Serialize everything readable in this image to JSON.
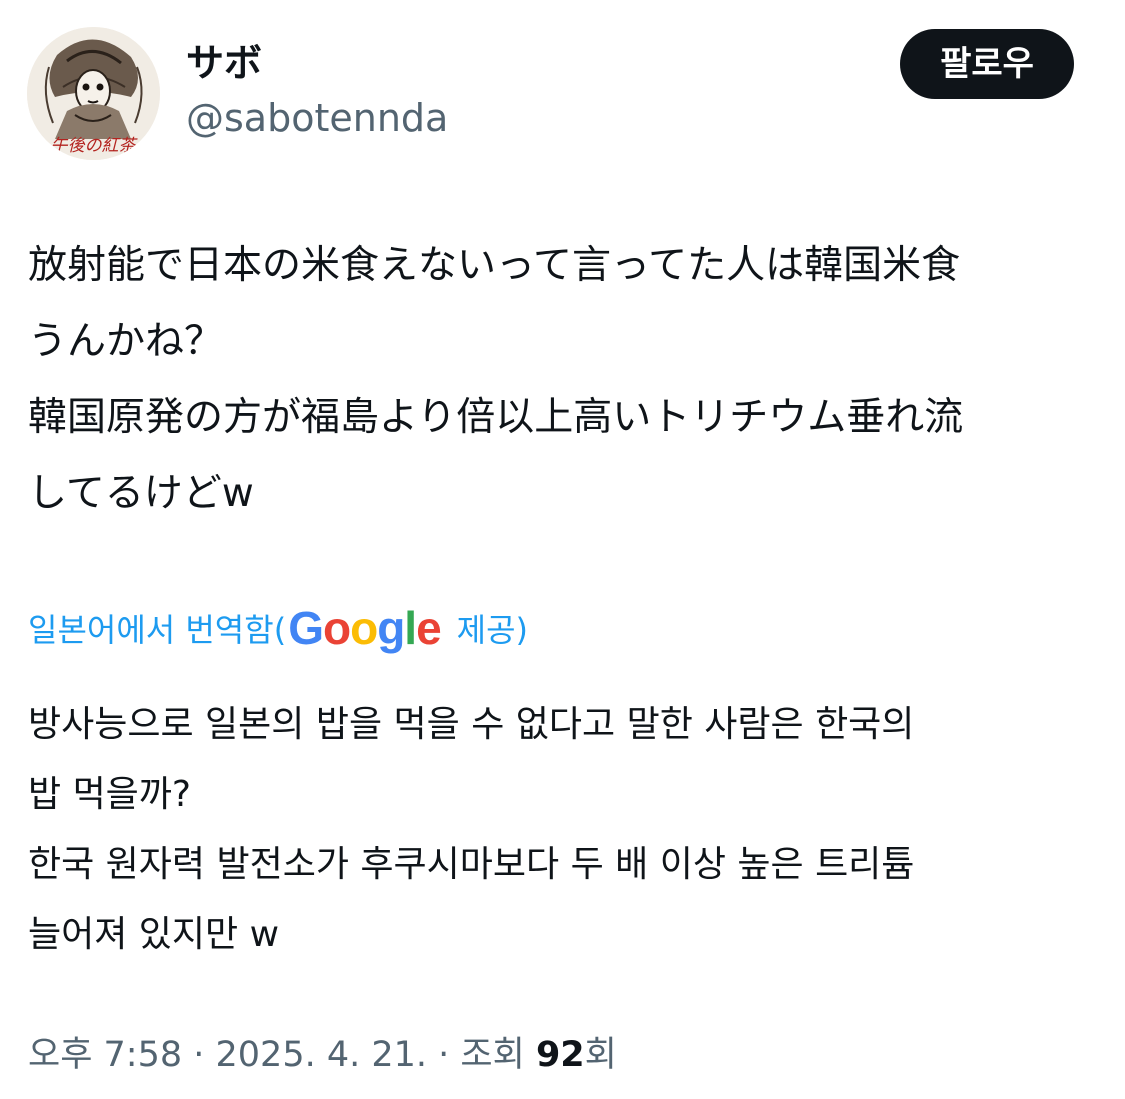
{
  "user": {
    "display_name": "サボ",
    "handle": "@sabotennda",
    "avatar_icon": "avatar-image",
    "avatar_text": "午後の紅茶"
  },
  "follow_button": {
    "label": "팔로우"
  },
  "tweet": {
    "original_lines": [
      "放射能で日本の米食えないって言ってた人は韓国米食",
      "うんかね？",
      "韓国原発の方が福島より倍以上高いトリチウム垂れ流",
      "してるけどw"
    ],
    "translation_prefix": "일본어에서 번역함(",
    "translation_provider": "Google",
    "translation_suffix": "제공)",
    "translated_lines": [
      "방사능으로 일본의 밥을 먹을 수 없다고 말한 사람은 한국의",
      "밥 먹을까?",
      "한국 원자력 발전소가 후쿠시마보다 두 배 이상 높은 트리튬",
      "늘어져 있지만 w"
    ]
  },
  "meta": {
    "time": "오후 7:58",
    "separator": " · ",
    "date": "2025. 4. 21.",
    "views_label": "조회 ",
    "views_count": "92",
    "views_suffix": "회"
  },
  "colors": {
    "text_primary": "#0f1419",
    "text_secondary": "#536471",
    "link": "#1d9bf0",
    "button_bg": "#0f1419",
    "google_blue": "#4285F4",
    "google_red": "#EA4335",
    "google_yellow": "#FBBC05",
    "google_green": "#34A853"
  }
}
